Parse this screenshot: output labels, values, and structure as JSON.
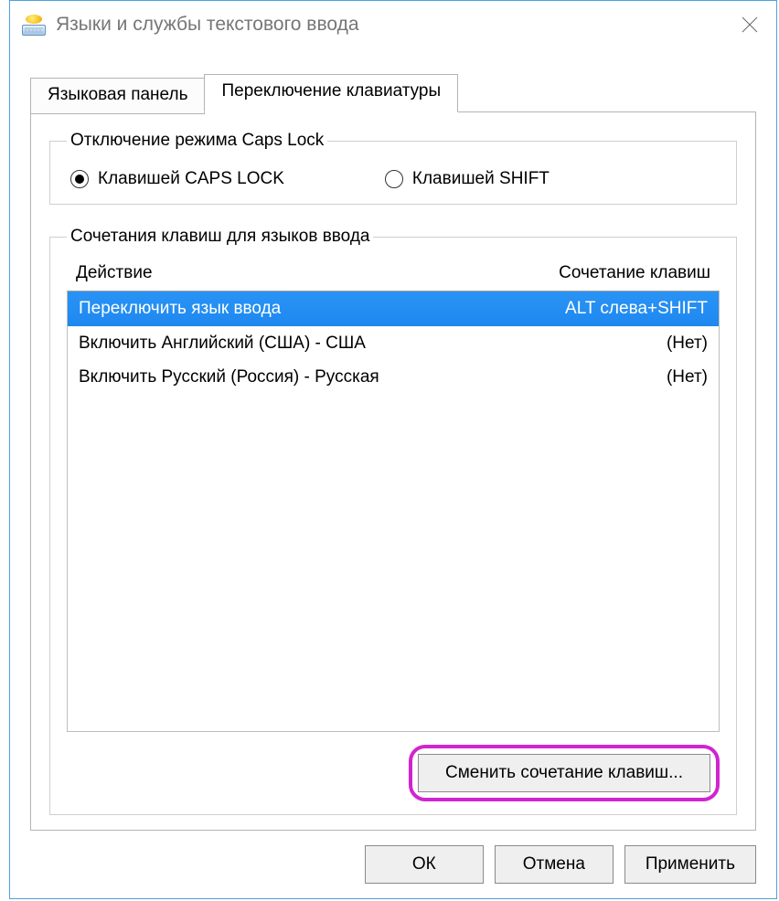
{
  "window": {
    "title": "Языки и службы текстового ввода"
  },
  "tabs": {
    "lang_panel": "Языковая панель",
    "kb_switch": "Переключение клавиатуры"
  },
  "capslock": {
    "group_label": "Отключение режима Caps Lock",
    "opt_caps": "Клавишей CAPS LOCK",
    "opt_shift": "Клавишей SHIFT"
  },
  "shortcuts": {
    "group_label": "Сочетания клавиш для языков ввода",
    "header_action": "Действие",
    "header_shortcut": "Сочетание клавиш",
    "rows": [
      {
        "action": "Переключить язык ввода",
        "shortcut": "ALT слева+SHIFT"
      },
      {
        "action": "Включить Английский (США) - США",
        "shortcut": "(Нет)"
      },
      {
        "action": "Включить Русский (Россия) - Русская",
        "shortcut": "(Нет)"
      }
    ],
    "change_button": "Сменить сочетание клавиш..."
  },
  "buttons": {
    "ok": "ОК",
    "cancel": "Отмена",
    "apply": "Применить"
  }
}
